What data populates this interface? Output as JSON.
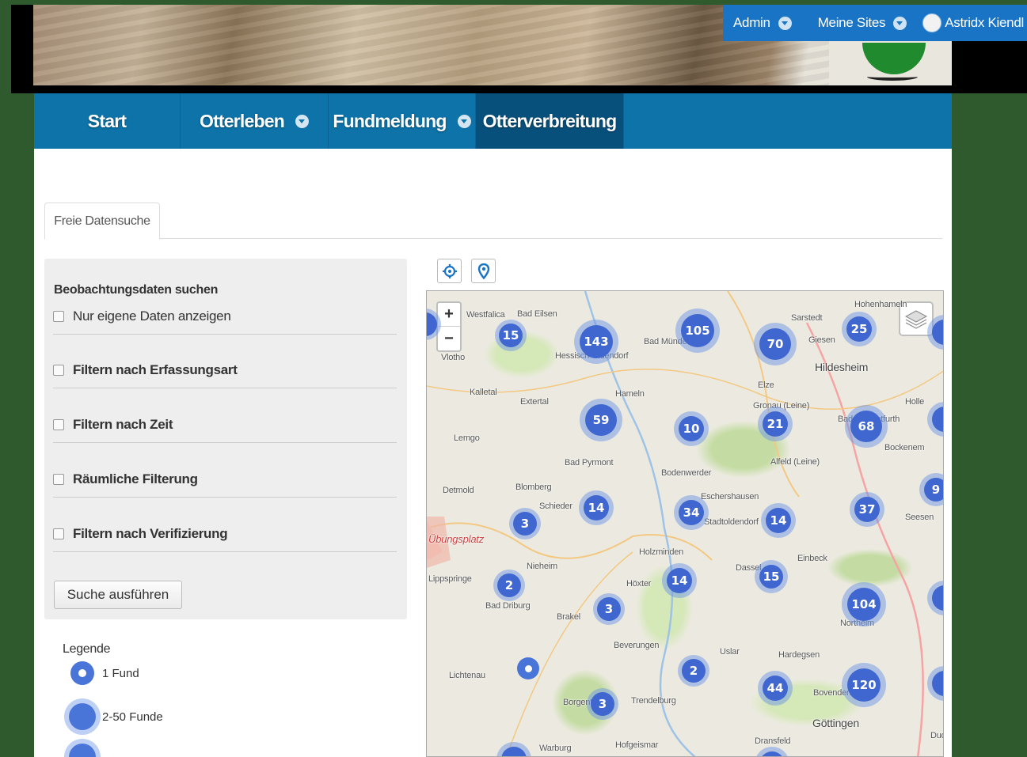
{
  "topbar": {
    "admin_label": "Admin",
    "sites_label": "Meine Sites",
    "user_name": "Astridx Kiendl"
  },
  "nav": {
    "items": [
      {
        "label": "Start",
        "has_dropdown": false
      },
      {
        "label": "Otterleben",
        "has_dropdown": true
      },
      {
        "label": "Fundmeldung",
        "has_dropdown": true
      },
      {
        "label": "Otterverbreitung",
        "has_dropdown": false,
        "active": true
      }
    ]
  },
  "tabs": {
    "active_label": "Freie Datensuche"
  },
  "filter": {
    "title": "Beobachtungsdaten suchen",
    "rows": [
      {
        "label": "Nur eigene Daten anzeigen",
        "checked": false
      },
      {
        "label": "Filtern nach Erfassungsart",
        "checked": false
      },
      {
        "label": "Filtern nach Zeit",
        "checked": false
      },
      {
        "label": "Räumliche Filterung",
        "checked": false
      },
      {
        "label": "Filtern nach Verifizierung",
        "checked": false
      }
    ],
    "search_button": "Suche ausführen"
  },
  "legend": {
    "title": "Legende",
    "items": [
      {
        "label": "1 Fund"
      },
      {
        "label": "2-50 Funde"
      }
    ]
  },
  "map": {
    "zoom_in": "+",
    "zoom_out": "−",
    "places": [
      {
        "name": "Westfalica"
      },
      {
        "name": "Bad Eilsen"
      },
      {
        "name": "Hohenhameln"
      },
      {
        "name": "Sarstedt"
      },
      {
        "name": "Giesen"
      },
      {
        "name": "Hildesheim"
      },
      {
        "name": "Vlotho"
      },
      {
        "name": "Hessisch Oldendorf"
      },
      {
        "name": "Bad Münder"
      },
      {
        "name": "Elze"
      },
      {
        "name": "Kalletal"
      },
      {
        "name": "Extertal"
      },
      {
        "name": "Hameln"
      },
      {
        "name": "Gronau (Leine)"
      },
      {
        "name": "Holle"
      },
      {
        "name": "Lemgo"
      },
      {
        "name": "Bad Salzdetfurth"
      },
      {
        "name": "Bockenem"
      },
      {
        "name": "Bad Pyrmont"
      },
      {
        "name": "Alfeld (Leine)"
      },
      {
        "name": "Detmold"
      },
      {
        "name": "Blomberg"
      },
      {
        "name": "Bodenwerder"
      },
      {
        "name": "Schieder"
      },
      {
        "name": "Eschershausen"
      },
      {
        "name": "Stadtoldendorf"
      },
      {
        "name": "Seesen"
      },
      {
        "name": "Übungsplatz"
      },
      {
        "name": "Holzminden"
      },
      {
        "name": "Nieheim"
      },
      {
        "name": "Einbeck"
      },
      {
        "name": "Dassel"
      },
      {
        "name": "Lippspringe"
      },
      {
        "name": "Höxter"
      },
      {
        "name": "Bad Driburg"
      },
      {
        "name": "Brakel"
      },
      {
        "name": "Northeim"
      },
      {
        "name": "Beverungen"
      },
      {
        "name": "Uslar"
      },
      {
        "name": "Hardegsen"
      },
      {
        "name": "Lichtenau"
      },
      {
        "name": "Bovenden"
      },
      {
        "name": "Borgentreich"
      },
      {
        "name": "Trendelburg"
      },
      {
        "name": "Göttingen"
      },
      {
        "name": "Dransfeld"
      },
      {
        "name": "Warburg"
      },
      {
        "name": "Hofgeismar"
      },
      {
        "name": "Duderstadt"
      }
    ],
    "clusters": [
      {
        "count": "15"
      },
      {
        "count": "143"
      },
      {
        "count": "105"
      },
      {
        "count": "70"
      },
      {
        "count": "25"
      },
      {
        "count": "59"
      },
      {
        "count": "10"
      },
      {
        "count": "21"
      },
      {
        "count": "68"
      },
      {
        "count": "9"
      },
      {
        "count": "14"
      },
      {
        "count": "34"
      },
      {
        "count": "14"
      },
      {
        "count": "37"
      },
      {
        "count": "3"
      },
      {
        "count": "14"
      },
      {
        "count": "15"
      },
      {
        "count": "2"
      },
      {
        "count": "3"
      },
      {
        "count": "104"
      },
      {
        "count": "2"
      },
      {
        "count": "44"
      },
      {
        "count": "120"
      },
      {
        "count": "3"
      }
    ]
  },
  "colors": {
    "topbar": "#1a74c6",
    "nav": "#0d73a8",
    "nav_active": "#08507c",
    "cluster": "#3f67cf",
    "page_bg": "#2e5a2e"
  }
}
